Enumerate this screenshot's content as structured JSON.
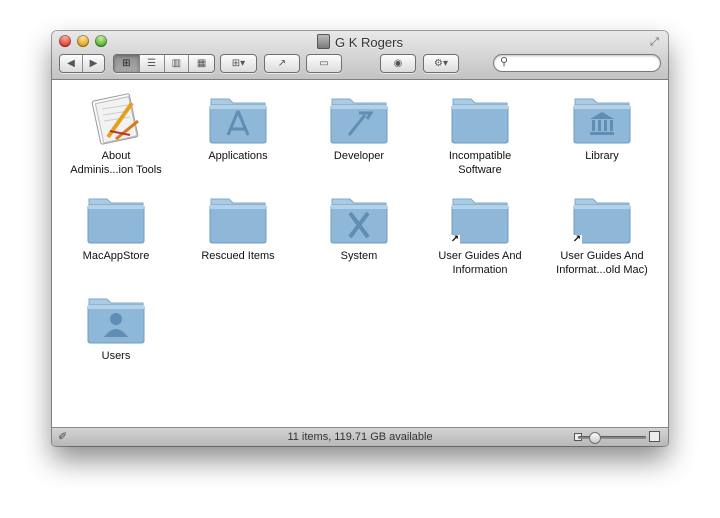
{
  "window": {
    "title": "G K Rogers"
  },
  "toolbar": {
    "nav": {
      "back": "◀",
      "forward": "▶"
    },
    "view_modes": [
      {
        "name": "icon-view",
        "glyph": "⊞",
        "active": true
      },
      {
        "name": "list-view",
        "glyph": "☰",
        "active": false
      },
      {
        "name": "column-view",
        "glyph": "▥",
        "active": false
      },
      {
        "name": "coverflow-view",
        "glyph": "▦",
        "active": false
      }
    ],
    "arrange_glyph": "⊞▾",
    "share_glyph": "↗",
    "path_glyph": "▭",
    "quicklook_glyph": "◉",
    "action_glyph": "⚙▾",
    "search": {
      "value": "",
      "placeholder": ""
    }
  },
  "items": [
    {
      "label": "About\nAdminis...ion Tools",
      "icon": "app-icon",
      "alias": false
    },
    {
      "label": "Applications",
      "icon": "applications-folder-icon",
      "alias": false
    },
    {
      "label": "Developer",
      "icon": "developer-folder-icon",
      "alias": false
    },
    {
      "label": "Incompatible\nSoftware",
      "icon": "folder-icon",
      "alias": false
    },
    {
      "label": "Library",
      "icon": "library-folder-icon",
      "alias": false
    },
    {
      "label": "MacAppStore",
      "icon": "folder-icon",
      "alias": false
    },
    {
      "label": "Rescued Items",
      "icon": "folder-icon",
      "alias": false
    },
    {
      "label": "System",
      "icon": "system-folder-icon",
      "alias": false
    },
    {
      "label": "User Guides And\nInformation",
      "icon": "folder-icon",
      "alias": true
    },
    {
      "label": "User Guides And\nInformat...old Mac)",
      "icon": "folder-icon",
      "alias": true
    },
    {
      "label": "Users",
      "icon": "users-folder-icon",
      "alias": false
    }
  ],
  "status": {
    "text": "11 items, 119.71 GB available",
    "zoom_level": 0.25
  },
  "colors": {
    "folder_top": "#a9cbe3",
    "folder_body": "#8fb8d8",
    "folder_emboss": "#6e9bbf"
  }
}
